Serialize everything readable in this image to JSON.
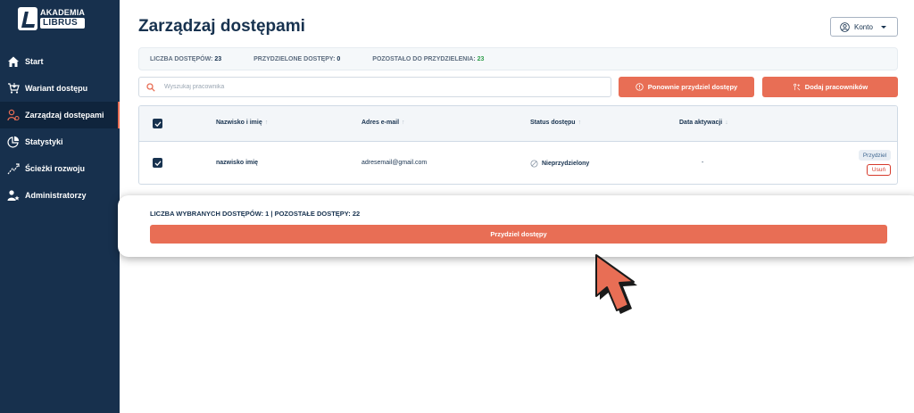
{
  "brand": {
    "line1": "AKADEMIA",
    "line2": "LIBRUS"
  },
  "sidebar": {
    "items": [
      {
        "label": "Start",
        "icon": "home-icon"
      },
      {
        "label": "Wariant dostępu",
        "icon": "cart-icon"
      },
      {
        "label": "Zarządzaj dostępami",
        "icon": "user-gear-icon",
        "active": true
      },
      {
        "label": "Statystyki",
        "icon": "pie-chart-icon"
      },
      {
        "label": "Ścieżki rozwoju",
        "icon": "path-icon"
      },
      {
        "label": "Administratorzy",
        "icon": "admin-star-icon"
      }
    ]
  },
  "page": {
    "title": "Zarządzaj dostępami"
  },
  "account": {
    "label": "Konto"
  },
  "stats": {
    "total_label": "LICZBA DOSTĘPÓW:",
    "total_value": "23",
    "assigned_label": "PRZYDZIELONE DOSTĘPY:",
    "assigned_value": "0",
    "remaining_label": "POZOSTAŁO DO PRZYDZIELENIA:",
    "remaining_value": "23"
  },
  "search": {
    "placeholder": "Wyszukaj pracownika",
    "value": ""
  },
  "actions": {
    "reassign_label": "Ponownie przydziel dostępy",
    "add_label": "Dodaj pracowników"
  },
  "table": {
    "headers": {
      "name": "Nazwisko i imię",
      "name_sort": "↑",
      "email": "Adres e-mail",
      "email_sort": "↑",
      "status": "Status dostępu",
      "status_sort": "↑",
      "activation": "Data aktywacji",
      "activation_sort": "↓"
    },
    "rows": [
      {
        "checked": true,
        "name": "nazwisko imię",
        "email": "adresemail@gmail.com",
        "status": "Nieprzydzielony",
        "activation": "-",
        "assign_label": "Przydziel",
        "remove_label": "Usuń"
      }
    ]
  },
  "selection": {
    "summary": "LICZBA WYBRANYCH DOSTĘPÓW: 1 | POZOSTAŁE DOSTĘPY: 22",
    "assign_button": "Przydziel dostępy"
  },
  "colors": {
    "sidebar": "#17304d",
    "accent": "#e86e55",
    "danger": "#d63a2b",
    "success": "#2e9d4b"
  }
}
